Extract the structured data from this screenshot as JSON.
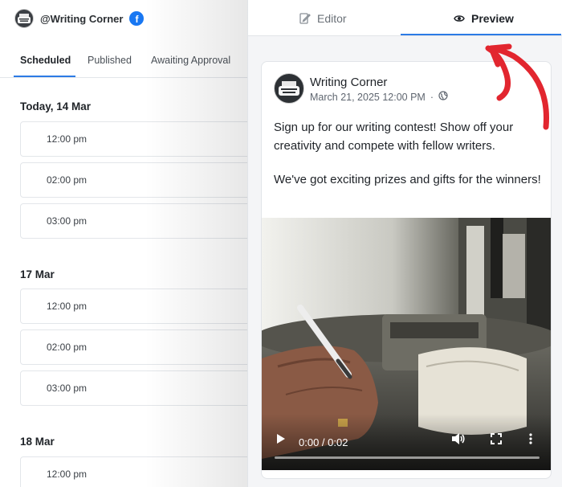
{
  "account": {
    "name": "@Writing Corner",
    "network_badge": "f",
    "network_icon": "facebook-icon",
    "avatar_icon": "typewriter-icon"
  },
  "tabs": [
    {
      "label": "Scheduled",
      "active": true
    },
    {
      "label": "Published",
      "active": false
    },
    {
      "label": "Awaiting Approval",
      "active": false
    }
  ],
  "schedule": [
    {
      "day": "Today, 14 Mar",
      "slots": [
        "12:00 pm",
        "02:00 pm",
        "03:00 pm"
      ]
    },
    {
      "day": "17 Mar",
      "slots": [
        "12:00 pm",
        "02:00 pm",
        "03:00 pm"
      ]
    },
    {
      "day": "18 Mar",
      "slots": [
        "12:00 pm"
      ]
    }
  ],
  "panel_tabs": {
    "editor": {
      "label": "Editor",
      "icon": "edit-icon",
      "active": false
    },
    "preview": {
      "label": "Preview",
      "icon": "eye-icon",
      "active": true
    }
  },
  "post": {
    "page_name": "Writing Corner",
    "timestamp": "March 21, 2025 12:00 PM",
    "separator": "·",
    "audience_icon": "globe-icon",
    "text_lines": [
      "Sign up for our writing contest! Show off your creativity and compete with fellow writers.",
      "We've got exciting prizes and gifts for the winners!"
    ],
    "video": {
      "time": "0:00 / 0:02",
      "progress": 0,
      "controls": [
        "play-icon",
        "volume-icon",
        "fullscreen-icon",
        "more-icon"
      ]
    }
  },
  "colors": {
    "accent": "#2c7be5",
    "facebook": "#1877f2",
    "annotation": "#e2262f"
  }
}
